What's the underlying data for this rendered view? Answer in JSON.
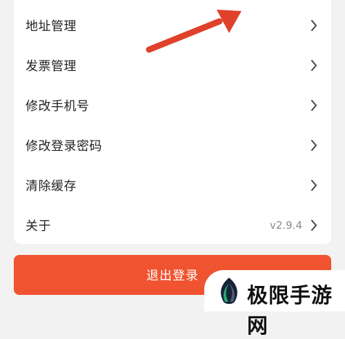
{
  "menu": {
    "items": [
      {
        "label": "地址管理"
      },
      {
        "label": "发票管理"
      },
      {
        "label": "修改手机号"
      },
      {
        "label": "修改登录密码"
      },
      {
        "label": "清除缓存"
      },
      {
        "label": "关于",
        "value": "v2.9.4"
      }
    ]
  },
  "logout": {
    "label": "退出登录"
  },
  "watermark": {
    "text": "极限手游网"
  },
  "colors": {
    "accent": "#f0532f",
    "arrow": "#e0412b",
    "text": "#222222",
    "muted": "#8a8a8a",
    "background": "#f2f2f2"
  },
  "icons": {
    "row_chevron": "chevron-right-icon",
    "annotation": "arrow-annotation-icon",
    "watermark_logo": "leaf-logo-icon"
  }
}
